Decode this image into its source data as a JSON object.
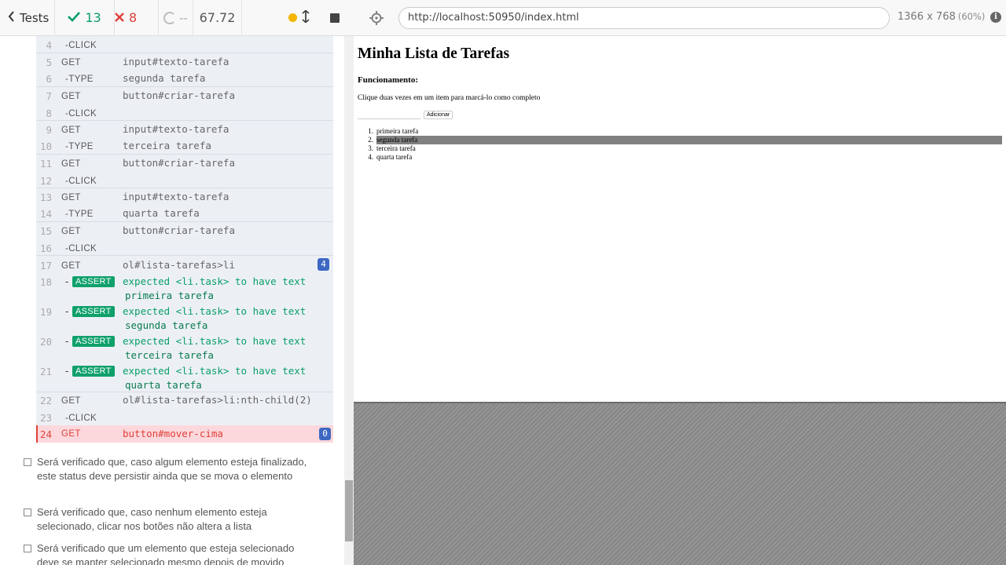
{
  "stats": {
    "back_label": "Tests",
    "passed": "13",
    "failed": "8",
    "pending": "--",
    "duration": "67.72"
  },
  "commands": [
    {
      "n": "4",
      "cmd": "-CLICK",
      "msg": ""
    },
    {
      "n": "5",
      "cmd": "GET",
      "msg": "input#texto-tarefa"
    },
    {
      "n": "6",
      "cmd": "-TYPE",
      "msg": "segunda tarefa"
    },
    {
      "n": "7",
      "cmd": "GET",
      "msg": "button#criar-tarefa"
    },
    {
      "n": "8",
      "cmd": "-CLICK",
      "msg": ""
    },
    {
      "n": "9",
      "cmd": "GET",
      "msg": "input#texto-tarefa"
    },
    {
      "n": "10",
      "cmd": "-TYPE",
      "msg": "terceira tarefa"
    },
    {
      "n": "11",
      "cmd": "GET",
      "msg": "button#criar-tarefa"
    },
    {
      "n": "12",
      "cmd": "-CLICK",
      "msg": ""
    },
    {
      "n": "13",
      "cmd": "GET",
      "msg": "input#texto-tarefa"
    },
    {
      "n": "14",
      "cmd": "-TYPE",
      "msg": "quarta tarefa"
    },
    {
      "n": "15",
      "cmd": "GET",
      "msg": "button#criar-tarefa"
    },
    {
      "n": "16",
      "cmd": "-CLICK",
      "msg": ""
    },
    {
      "n": "17",
      "cmd": "GET",
      "msg": "ol#lista-tarefas>li",
      "count": "4"
    }
  ],
  "asserts": [
    {
      "n": "18",
      "badge": "ASSERT",
      "msg": "expected <li.task> to have text",
      "value": "primeira tarefa"
    },
    {
      "n": "19",
      "badge": "ASSERT",
      "msg": "expected <li.task> to have text",
      "value": "segunda tarefa"
    },
    {
      "n": "20",
      "badge": "ASSERT",
      "msg": "expected <li.task> to have text",
      "value": "terceira tarefa"
    },
    {
      "n": "21",
      "badge": "ASSERT",
      "msg": "expected <li.task> to have text",
      "value": "quarta tarefa"
    }
  ],
  "tail_commands": [
    {
      "n": "22",
      "cmd": "GET",
      "msg": "ol#lista-tarefas>li:nth-child(2)"
    },
    {
      "n": "23",
      "cmd": "-CLICK",
      "msg": ""
    }
  ],
  "error_command": {
    "n": "24",
    "cmd": "GET",
    "msg": "button#mover-cima",
    "count": "0"
  },
  "tests": [
    "Será verificado que, caso algum elemento esteja finalizado, este status deve persistir ainda que se mova o elemento",
    "Será verificado que, caso nenhum elemento esteja selecionado, clicar nos botões não altera a lista",
    "Será verificado que um elemento que esteja selecionado deve se manter selecionado mesmo depois de movido"
  ],
  "aut": {
    "url": "http://localhost:50950/index.html",
    "viewport": "1366 x 768",
    "scale": "(60%)",
    "info_icon": "i"
  },
  "app": {
    "title": "Minha Lista de Tarefas",
    "subtitle": "Funcionamento:",
    "instructions": "Clique duas vezes em um item para marcá-lo como completo",
    "add_button": "Adicionar",
    "tasks": [
      {
        "num": "1.",
        "text": "primeira tarefa",
        "selected": false
      },
      {
        "num": "2.",
        "text": "segunda tarefa",
        "selected": true
      },
      {
        "num": "3.",
        "text": "terceira tarefa",
        "selected": false
      },
      {
        "num": "4.",
        "text": "quarta tarefa",
        "selected": false
      }
    ]
  },
  "colors": {
    "passed": "#0a9e67",
    "failed": "#e0403a",
    "assert_badge": "#0fa06b",
    "count_badge": "#3d68c2",
    "error_row": "#fcd8dc",
    "selected_task": "#808080"
  },
  "icons": {
    "back": "chevron-left-icon",
    "passed": "check-icon",
    "failed": "x-icon",
    "pending": "spinner-icon",
    "status": "status-dot-icon",
    "scroll": "scroll-toggle-icon",
    "stop": "stop-icon",
    "selector": "crosshair-icon",
    "info": "info-icon"
  }
}
